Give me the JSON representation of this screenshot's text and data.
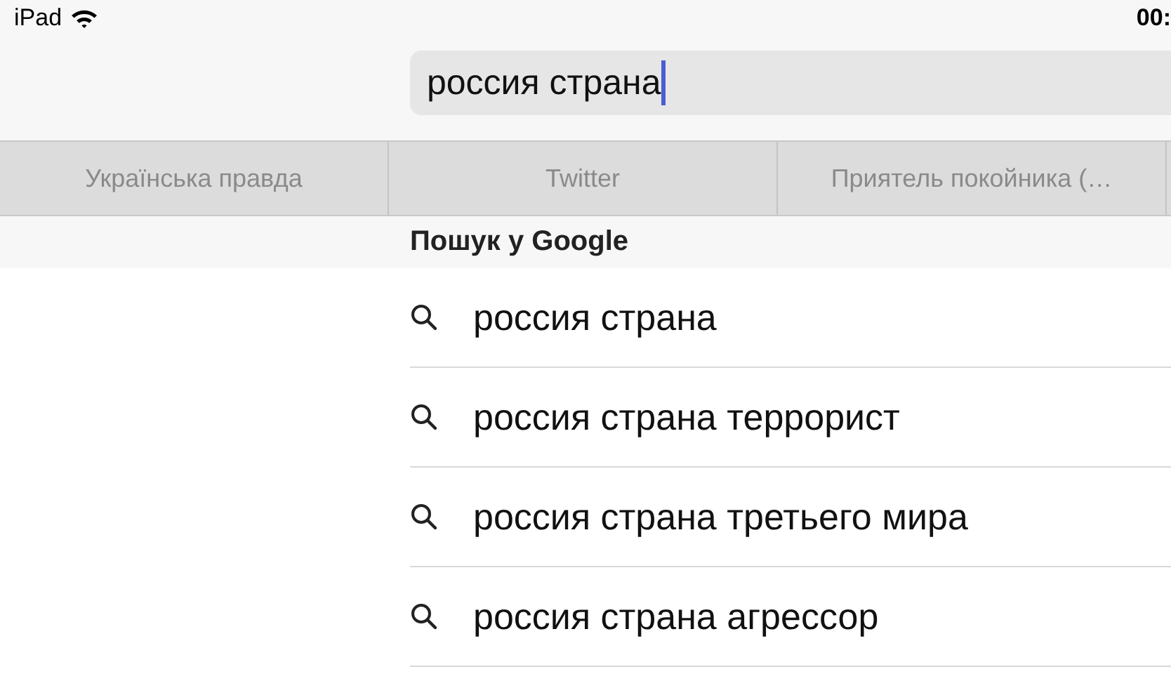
{
  "status_bar": {
    "device": "iPad",
    "time": "00:"
  },
  "address_bar": {
    "value": "россия страна"
  },
  "bookmarks": [
    {
      "label": "Українська правда"
    },
    {
      "label": "Twitter"
    },
    {
      "label": "Приятель покойника (…"
    }
  ],
  "section_header": "Пошук у Google",
  "suggestions": [
    {
      "text": "россия страна"
    },
    {
      "text": "россия страна террорист"
    },
    {
      "text": "россия страна третьего мира"
    },
    {
      "text": "россия страна агрессор"
    }
  ]
}
